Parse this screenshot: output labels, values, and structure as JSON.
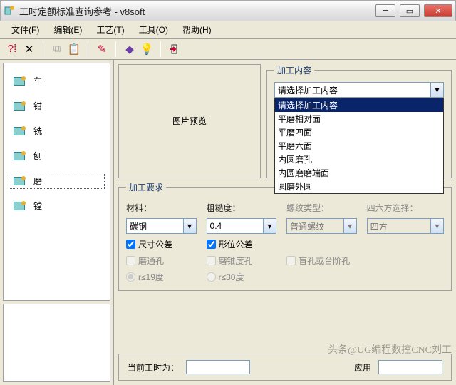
{
  "window": {
    "title": "工时定额标准查询参考 - v8soft"
  },
  "menu": {
    "items": [
      {
        "label": "文件(F)"
      },
      {
        "label": "编辑(E)"
      },
      {
        "label": "工艺(T)"
      },
      {
        "label": "工具(O)"
      },
      {
        "label": "帮助(H)"
      }
    ]
  },
  "sidebar": {
    "items": [
      {
        "label": "车"
      },
      {
        "label": "钳"
      },
      {
        "label": "铣"
      },
      {
        "label": "刨"
      },
      {
        "label": "磨"
      },
      {
        "label": "镗"
      }
    ],
    "selected_index": 4
  },
  "preview": {
    "caption": "图片预览"
  },
  "processing": {
    "legend": "加工内容",
    "placeholder": "请选择加工内容",
    "dropdown_open": true,
    "options": [
      "请选择加工内容",
      "平磨相对面",
      "平磨四面",
      "平磨六面",
      "内圆磨孔",
      "内圆磨磨端面",
      "圆磨外圆"
    ]
  },
  "requirements": {
    "legend": "加工要求",
    "material_label": "材料：",
    "material_value": "碳钢",
    "roughness_label": "粗糙度：",
    "roughness_value": "0.4",
    "thread_label": "螺纹类型：",
    "thread_value": "普通螺纹",
    "square_label": "四六方选择：",
    "square_value": "四方",
    "dim_tol": "尺寸公差",
    "geo_tol": "形位公差",
    "thru_hole": "磨通孔",
    "taper_hole": "磨锥度孔",
    "blind_hole": "盲孔或台阶孔",
    "angle19": "r≤19度",
    "angle30": "r≤30度"
  },
  "footer": {
    "current_label": "当前工时为：",
    "apply_label": "应用"
  },
  "watermark": "头条@UG编程数控CNC刘工"
}
